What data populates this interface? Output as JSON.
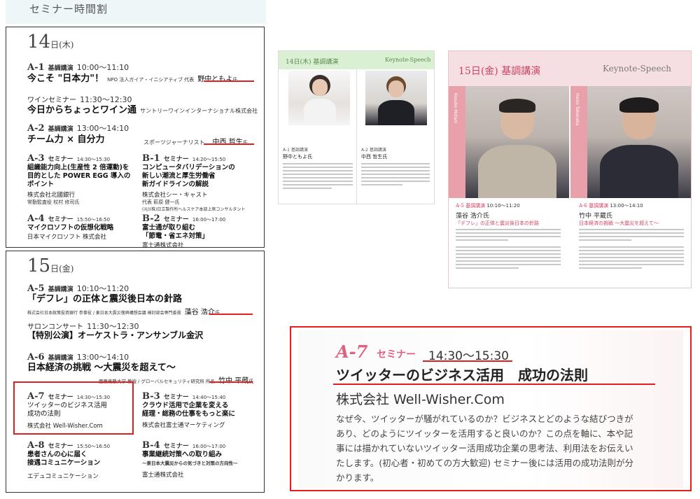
{
  "header": {
    "title": "セミナー時間割"
  },
  "day14": {
    "day": "14",
    "suffix": "日(木)",
    "a1": {
      "code": "A-1",
      "tag": "基調講演",
      "time": "10:00～11:10",
      "title": "今こそ \"日本力\"！",
      "org": "NPO 法人ガイア・イニシアティブ 代表",
      "speaker": "野中ともよ",
      "hon": "氏"
    },
    "wine": {
      "label": "ワインセミナー",
      "time": "11:30～12:30",
      "title": "今日からちょっとワイン通",
      "org": "サントリーワインインターナショナル株式会社"
    },
    "a2": {
      "code": "A-2",
      "tag": "基調講演",
      "time": "13:00～14:10",
      "title": "チーム力 × 自分力",
      "org": "スポーツジャーナリスト",
      "speaker": "中西 哲生",
      "hon": "氏"
    },
    "a3": {
      "code": "A-3",
      "tag": "セミナー",
      "time": "14:30～15:30",
      "lines": [
        "組織能力向上(生産性 2 倍運動)を",
        "目的とした POWER EGG 導入の",
        "ポイント"
      ],
      "company": "株式会社北國銀行",
      "person": "常勤監査役 杖村 修司氏"
    },
    "b1": {
      "code": "B-1",
      "tag": "セミナー",
      "time": "14:20～15:50",
      "lines": [
        "コンピュータバリデーションの",
        "新しい潮流と厚生労働省",
        "新ガイドラインの解説"
      ],
      "company": "株式会社シー・キャスト",
      "person": "代表 萩原 健一氏",
      "note": "(元)(株)日立製作所ヘルスケア本部上席コンサルタント"
    },
    "a4": {
      "code": "A-4",
      "tag": "セミナー",
      "time": "15:50～16:50",
      "lines": [
        "マイクロソフトの仮想化戦略"
      ],
      "company": "日本マイクロソフト 株式会社"
    },
    "b2": {
      "code": "B-2",
      "tag": "セミナー",
      "time": "16:00～17:00",
      "lines": [
        "富士通が取り組む",
        "「節電・省エネ対策」"
      ],
      "company": "富士通株式会社"
    }
  },
  "day15": {
    "day": "15",
    "suffix": "日(金)",
    "a5": {
      "code": "A-5",
      "tag": "基調講演",
      "time": "10:10～11:20",
      "title": "「デフレ」の正体と震災後日本の針路",
      "org": "株式会社日本政策投資銀行 参事役 / 東日本大震災復興構想会議 検討部会専門委員",
      "speaker": "藻谷 浩介",
      "hon": "氏"
    },
    "salon": {
      "label": "サロンコンサート",
      "time": "11:30～12:30",
      "title": "【特別公演】オーケストラ・アンサンブル金沢"
    },
    "a6": {
      "code": "A-6",
      "tag": "基調講演",
      "time": "13:00～14:10",
      "title": "日本経済の挑戦 ～大震災を超えて～",
      "org": "慶應義塾大学 教授 / グローバルセキュリティ研究所 所長",
      "speaker": "竹中 平蔵",
      "hon": "氏"
    },
    "a7": {
      "code": "A-7",
      "tag": "セミナー",
      "time": "14:30～15:30",
      "lines": [
        "ツイッターのビジネス活用",
        "成功の法則"
      ],
      "company": "株式会社 Well-Wisher.Com"
    },
    "b3": {
      "code": "B-3",
      "tag": "セミナー",
      "time": "14:40～15:40",
      "lines": [
        "クラウド活用で企業を変える",
        "経理・総務の仕事をもっと楽に"
      ],
      "company": "株式会社富士通マーケティング"
    },
    "a8": {
      "code": "A-8",
      "tag": "セミナー",
      "time": "15:50～16:50",
      "lines": [
        "患者さんの心に届く",
        "接遇コミュニケーション"
      ],
      "company": "エデュコミュニケーション"
    },
    "b4": {
      "code": "B-4",
      "tag": "セミナー",
      "time": "16:00～17:00",
      "lines": [
        "事業継続対策への取り組み",
        "～東日本大震災からの気づきと対策の方向性～"
      ],
      "company": "富士通株式会社"
    }
  },
  "spread": {
    "left_heading": "14日(木) 基調講演",
    "right_heading": "Keynote-Speech",
    "a1_code": "A-1",
    "a1_tag": "基調講演",
    "a1_name": "野中ともよ氏",
    "a2_code": "A-2",
    "a2_tag": "基調講演",
    "a2_name": "中西 哲生氏"
  },
  "keynote": {
    "heading": "15日(金) 基調講演",
    "brand": "Keynote-Speech",
    "left": {
      "code": "A-5",
      "tag": "基調講演",
      "time": "10:10～11:20",
      "name": "藻谷 浩介氏",
      "title": "「デフレ」の正体と震災後日本の針路",
      "side": "Kosuke Motani"
    },
    "right": {
      "code": "A-6",
      "tag": "基調講演",
      "time": "13:00～14:10",
      "name": "竹中 平蔵氏",
      "title": "日本経済の挑戦 ～大震災を超えて～",
      "side": "Heizo Takenaka"
    }
  },
  "zoom": {
    "code": "A-7",
    "tag": "セミナー",
    "time": "14:30～15:30",
    "title": "ツイッターのビジネス活用　成功の法則",
    "company": "株式会社 Well-Wisher.Com",
    "body": [
      "なぜ今、ツイッターが騒がれているのか？ビジネスとどのような結びつきが",
      "あり、どのようにツイッターを活用すると良いのか？この点を軸に、本や記",
      "事には描かれていないツイッター活用成功企業の思考法、利用法をお伝えい",
      "たします。(初心者・初めての方大歓迎) セミナー後には活用の成功法則が分",
      "かります。"
    ]
  }
}
